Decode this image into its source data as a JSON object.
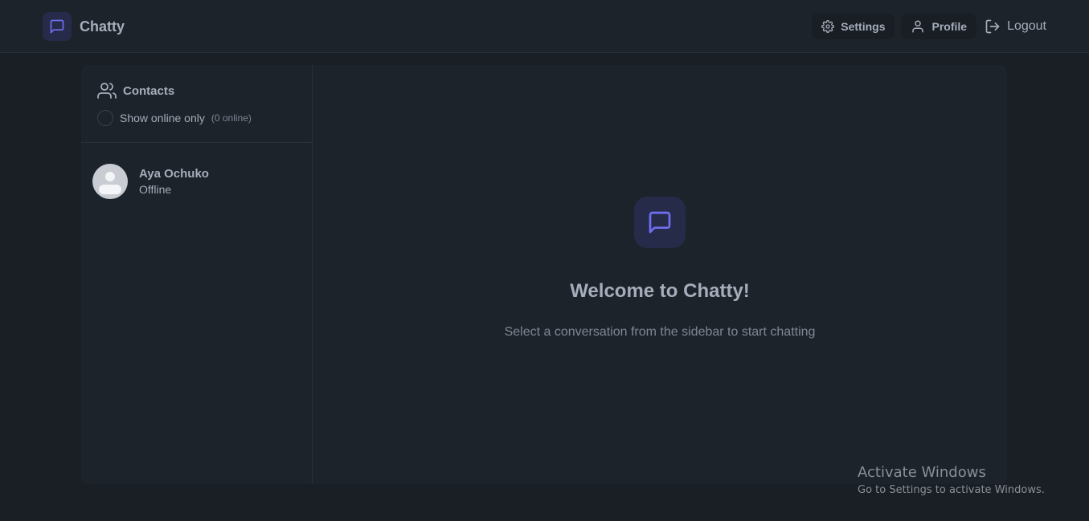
{
  "app": {
    "name": "Chatty"
  },
  "nav": {
    "settings": "Settings",
    "profile": "Profile",
    "logout": "Logout"
  },
  "sidebar": {
    "title": "Contacts",
    "online_toggle_label": "Show online only",
    "online_count": "(0 online)",
    "contacts": [
      {
        "name": "Aya Ochuko",
        "status": "Offline"
      }
    ]
  },
  "main": {
    "welcome_title": "Welcome to Chatty!",
    "welcome_subtitle": "Select a conversation from the sidebar to start chatting"
  },
  "watermark": {
    "title": "Activate Windows",
    "subtitle": "Go to Settings to activate Windows."
  },
  "colors": {
    "accent": "#6f6ff0",
    "page_bg": "#1a1e25",
    "panel_bg": "#1d232a",
    "icon_tile_bg": "#262b4a"
  },
  "icons": {
    "brand": "message-square-icon",
    "settings": "gear-icon",
    "profile": "user-icon",
    "logout": "logout-icon",
    "contacts": "users-icon",
    "welcome": "message-square-icon"
  }
}
